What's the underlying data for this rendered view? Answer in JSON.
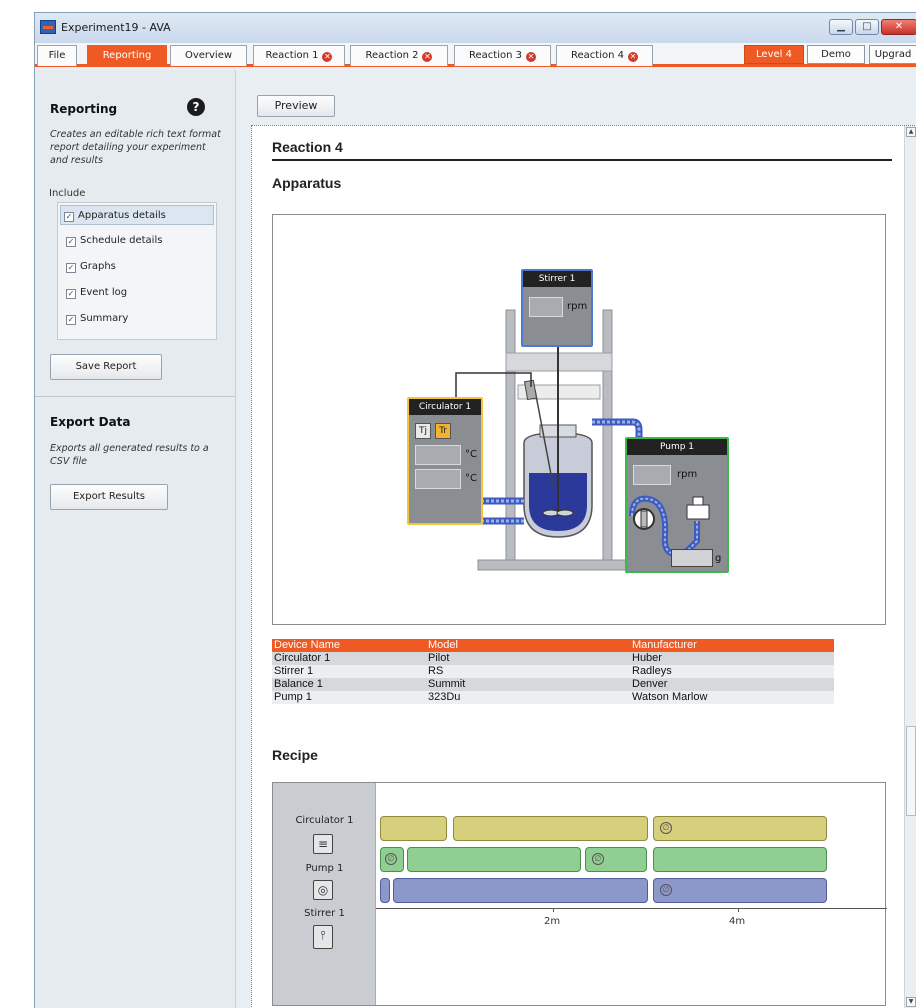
{
  "window": {
    "title": "Experiment19 - AVA"
  },
  "tabs": [
    {
      "label": "File"
    },
    {
      "label": "Reporting"
    },
    {
      "label": "Overview"
    },
    {
      "label": "Reaction 1"
    },
    {
      "label": "Reaction 2"
    },
    {
      "label": "Reaction 3"
    },
    {
      "label": "Reaction 4"
    }
  ],
  "right_buttons": {
    "level": "Level 4",
    "demo": "Demo",
    "upgrade": "Upgrad"
  },
  "sidebar": {
    "reporting_title": "Reporting",
    "reporting_desc": "Creates an editable rich text format report detailing your experiment and results",
    "include_label": "Include",
    "include_items": [
      {
        "label": "Apparatus details",
        "checked": true
      },
      {
        "label": "Schedule details",
        "checked": true
      },
      {
        "label": "Graphs",
        "checked": true
      },
      {
        "label": "Event log",
        "checked": true
      },
      {
        "label": "Summary",
        "checked": true
      }
    ],
    "save_report": "Save Report",
    "export_title": "Export Data",
    "export_desc": "Exports all generated results to a CSV file",
    "export_results": "Export Results"
  },
  "main": {
    "preview_button": "Preview",
    "reaction_heading": "Reaction 4",
    "apparatus_heading": "Apparatus",
    "recipe_heading": "Recipe"
  },
  "apparatus": {
    "stirrer": {
      "title": "Stirrer 1",
      "unit": "rpm"
    },
    "circulator": {
      "title": "Circulator 1",
      "tj": "Tj",
      "tr": "Tr",
      "unit1": "°C",
      "unit2": "°C"
    },
    "pump": {
      "title": "Pump 1",
      "unit": "rpm",
      "balance_unit": "g"
    },
    "colors": {
      "circulator": "#f2c53d",
      "stirrer": "#4a7bd0",
      "pump": "#3cb84a",
      "liquid": "#2b3a9a"
    }
  },
  "device_table": {
    "headers": [
      "Device Name",
      "Model",
      "Manufacturer"
    ],
    "rows": [
      [
        "Circulator 1",
        "Pilot",
        "Huber"
      ],
      [
        "Stirrer 1",
        "RS",
        "Radleys"
      ],
      [
        "Balance 1",
        "Summit",
        "Denver"
      ],
      [
        "Pump 1",
        "323Du",
        "Watson Marlow"
      ]
    ]
  },
  "recipe": {
    "devices": [
      "Circulator 1",
      "Pump 1",
      "Stirrer 1"
    ],
    "ticks": [
      "2m",
      "4m"
    ]
  }
}
